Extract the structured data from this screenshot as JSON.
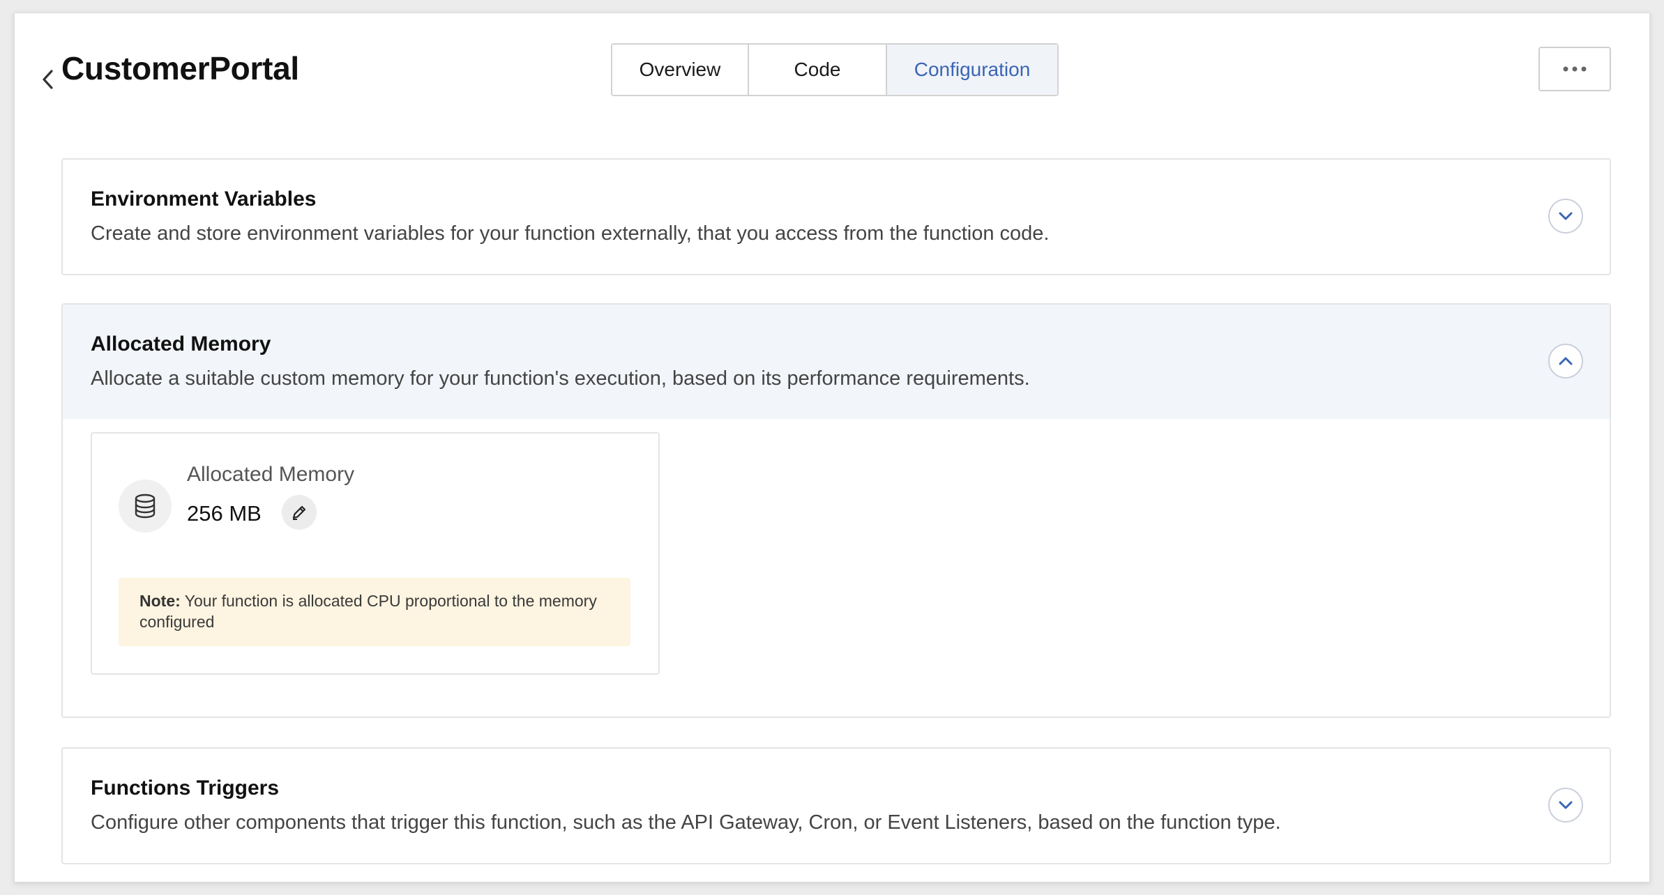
{
  "header": {
    "title": "CustomerPortal",
    "back_icon": "chevron-left-icon",
    "more_icon": "more-horizontal-icon"
  },
  "tabs": [
    {
      "label": "Overview",
      "active": false
    },
    {
      "label": "Code",
      "active": false
    },
    {
      "label": "Configuration",
      "active": true
    }
  ],
  "sections": {
    "env": {
      "title": "Environment Variables",
      "description": "Create and store environment variables for your function externally, that you access from the function code.",
      "expanded": false
    },
    "memory": {
      "title": "Allocated Memory",
      "description": "Allocate a suitable custom memory for your function's execution, based on its performance requirements.",
      "expanded": true,
      "card": {
        "label": "Allocated Memory",
        "value": "256 MB",
        "icon": "database-icon",
        "edit_icon": "pencil-icon",
        "note_prefix": "Note:",
        "note_text": " Your function is allocated CPU proportional to the memory configured"
      }
    },
    "triggers": {
      "title": "Functions Triggers",
      "description": "Configure other components that trigger this function, such as the API Gateway, Cron, or Event Listeners, based on the function type.",
      "expanded": false
    }
  },
  "colors": {
    "accent": "#3a65b5",
    "panel_header_bg": "#f2f5f9",
    "note_bg": "#fdf4e1"
  }
}
